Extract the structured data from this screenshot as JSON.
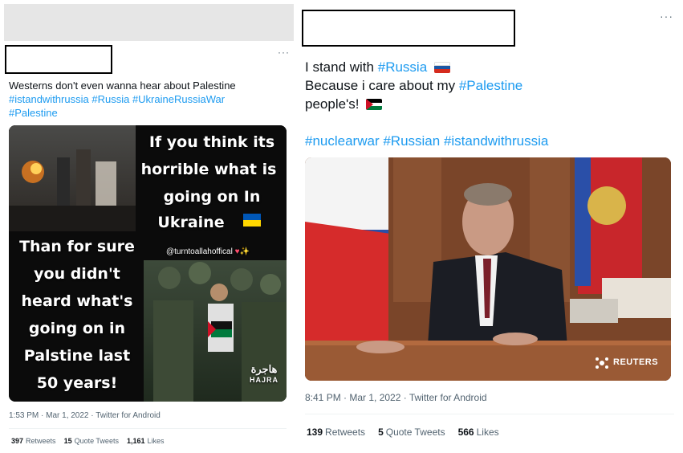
{
  "left_tweet": {
    "text_line1": "Westerns don't even wanna hear about Palestine",
    "hashtags_line2": [
      "#istandwithrussia",
      "#Russia",
      "#UkraineRussiaWar"
    ],
    "hashtag_line3": "#Palestine",
    "image": {
      "text_top": [
        "If you think its",
        "horrible what is",
        "going on In",
        "Ukraine"
      ],
      "text_bottom": [
        "Than for sure",
        "you didn't",
        "heard what's",
        "going on in",
        "Palstine last",
        "50 years!"
      ],
      "handle": "@turntoallahoffical",
      "handle_emoji": "♥✨",
      "watermark_arabic": "هاجرة",
      "watermark_latin": "HAJRA"
    },
    "meta": "1:53 PM · Mar 1, 2022 · Twitter for Android",
    "stats": {
      "retweets_count": "397",
      "retweets_label": "Retweets",
      "quotes_count": "15",
      "quotes_label": "Quote Tweets",
      "likes_count": "1,161",
      "likes_label": "Likes"
    },
    "more_icon": "···"
  },
  "right_tweet": {
    "line1_text": "I stand with",
    "line1_hashtag": "#Russia",
    "line2_text": "Because i care about my",
    "line2_hashtag": "#Palestine",
    "line3_text": "people's!",
    "hashtags_line": [
      "#nuclearwar",
      "#Russian",
      "#istandwithrussia"
    ],
    "image": {
      "source_logo": "REUTERS"
    },
    "meta": "8:41 PM · Mar 1, 2022 · Twitter for Android",
    "stats": {
      "retweets_count": "139",
      "retweets_label": "Retweets",
      "quotes_count": "5",
      "quotes_label": "Quote Tweets",
      "likes_count": "566",
      "likes_label": "Likes"
    },
    "more_icon": "···"
  },
  "icons": [
    "more-horizontal-icon",
    "russia-flag-icon",
    "palestine-flag-icon",
    "ukraine-flag-icon",
    "reuters-logo-icon"
  ],
  "colors": {
    "hashtag": "#1d9bf0",
    "meta_text": "#536471",
    "placeholder_bar": "#e6e6e6",
    "text": "#0f1419"
  }
}
